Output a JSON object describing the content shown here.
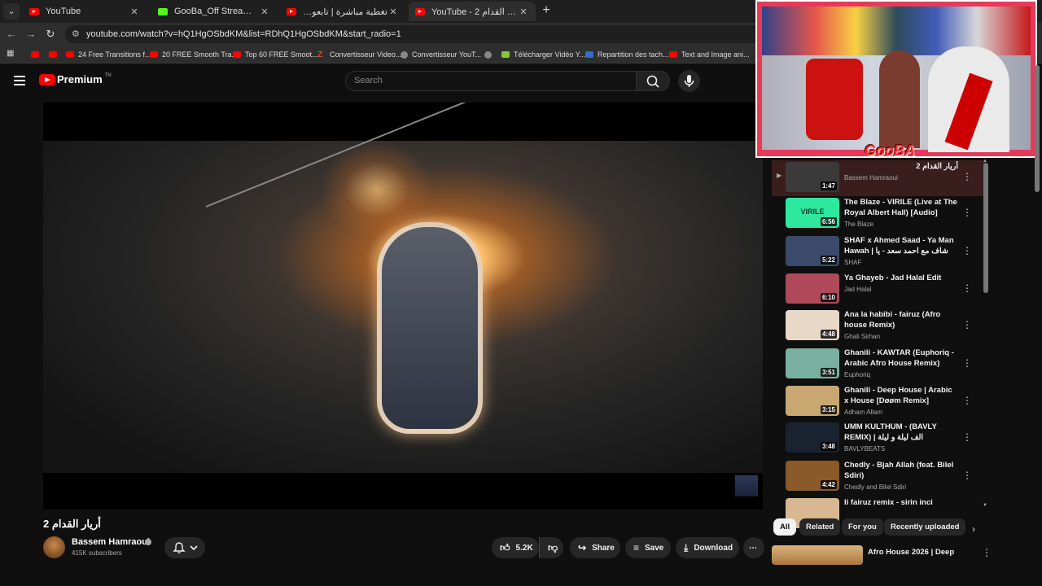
{
  "browser": {
    "tabs": [
      {
        "title": "YouTube",
        "icon": "youtube-icon"
      },
      {
        "title": "GooBa_Off Stream - Watch Live",
        "icon": "kick-icon"
      },
      {
        "title": "تغطية مباشرة | تابعوا التطورات ال...",
        "icon": "youtube-icon"
      },
      {
        "title": "YouTube - 2 أريار القدام",
        "icon": "youtube-icon"
      }
    ],
    "url": "youtube.com/watch?v=hQ1HgOSbdKM&list=RDhQ1HgOSbdKM&start_radio=1",
    "bookmarks": [
      {
        "label": ""
      },
      {
        "label": ""
      },
      {
        "label": "24 Free Transitions f..."
      },
      {
        "label": "20 FREE Smooth Tra..."
      },
      {
        "label": "Top 60 FREE Smoot..."
      },
      {
        "label": "Convertisseur Video..."
      },
      {
        "label": "Convertisseur YouT..."
      },
      {
        "label": ""
      },
      {
        "label": "Télécharger Vidéo Y..."
      },
      {
        "label": "Repartition des tach..."
      },
      {
        "label": "Text and Image ani..."
      }
    ]
  },
  "header": {
    "brand": "Premium",
    "brand_sup": "TN",
    "search_placeholder": "Search"
  },
  "video": {
    "title": "أريار القدام 2",
    "channel": "Bassem Hamraoui",
    "subscribers": "415K subscribers",
    "likes": "5.2K",
    "share_label": "Share",
    "save_label": "Save",
    "download_label": "Download"
  },
  "overlay": {
    "brand": "GooBA"
  },
  "playlist": {
    "items": [
      {
        "title": "أريار القدام 2",
        "channel": "Bassem Hamraoui",
        "duration": "1:47",
        "current": true,
        "thumb": "#3a3a3a"
      },
      {
        "title": "The Blaze - VIRILE (Live at The Royal Albert Hall) [Audio]",
        "channel": "The Blaze",
        "duration": "6:56",
        "thumb": "#2ee8a0",
        "thumb_text": "VIRILE"
      },
      {
        "title": "SHAF x Ahmed Saad - Ya Man Hawah | شاف مع احمد سعد - يا من هواه",
        "channel": "SHAF",
        "duration": "5:22",
        "thumb": "#3b4a6a"
      },
      {
        "title": "Ya Ghayeb - Jad Halal Edit",
        "channel": "Jad Halal",
        "duration": "6:10",
        "thumb": "#b04a5a"
      },
      {
        "title": "Ana la habibi - fairuz (Afro house Remix)",
        "channel": "Ghali Sirhan",
        "duration": "4:48",
        "thumb": "#e8d8c8"
      },
      {
        "title": "Ghanili - KAWTAR (Euphoriq - Arabic Afro House Remix)",
        "channel": "Euphoriq",
        "duration": "3:51",
        "thumb": "#7ab0a0"
      },
      {
        "title": "Ghanili - Deep House | Arabic x House [Døøm Remix]",
        "channel": "Adham Allam",
        "duration": "3:15",
        "thumb": "#c8a870"
      },
      {
        "title": "UMM KULTHUM - (BAVLY REMIX) | الف ليلة و ليلة",
        "channel": "BAVLYBEATS",
        "duration": "3:48",
        "thumb": "#1a2230"
      },
      {
        "title": "Chedly - Bjah Allah (feat. Bilel Sdiri)",
        "channel": "Chedly and Bilel Sdiri",
        "duration": "4:42",
        "thumb": "#8a5a2a"
      },
      {
        "title": "li fairuz remix - sirin inci",
        "channel": "",
        "duration": "",
        "thumb": "#d8b890"
      }
    ]
  },
  "chips": [
    "All",
    "Related",
    "For you",
    "Recently uploaded"
  ],
  "recommendation": {
    "title": "Afro House 2026 | Deep"
  }
}
